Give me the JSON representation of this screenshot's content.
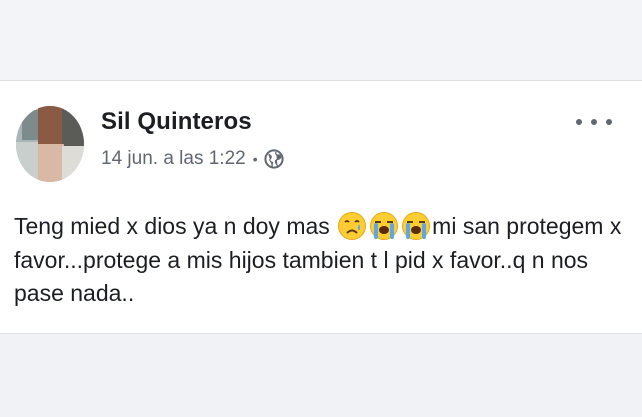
{
  "post": {
    "author_name": "Sil Quinteros",
    "timestamp": "14 jun. a las 1:22",
    "separator": "•",
    "privacy_icon": "globe-icon",
    "more_icon": "more-options-icon",
    "body_text_1": "Teng mied x dios ya n doy mas ",
    "emojis": [
      "sad-but-relieved-face-emoji",
      "loudly-crying-face-emoji",
      "loudly-crying-face-emoji"
    ],
    "body_text_2": "mi san protegem x favor...protege a mis hijos tambien t l pid x favor..q n nos pase nada.."
  },
  "colors": {
    "name": "#1c1e21",
    "meta": "#606770",
    "emoji_face": "#ffcc33",
    "tears": "#5aa8e8",
    "background": "#f1f2f5",
    "card": "#ffffff"
  }
}
